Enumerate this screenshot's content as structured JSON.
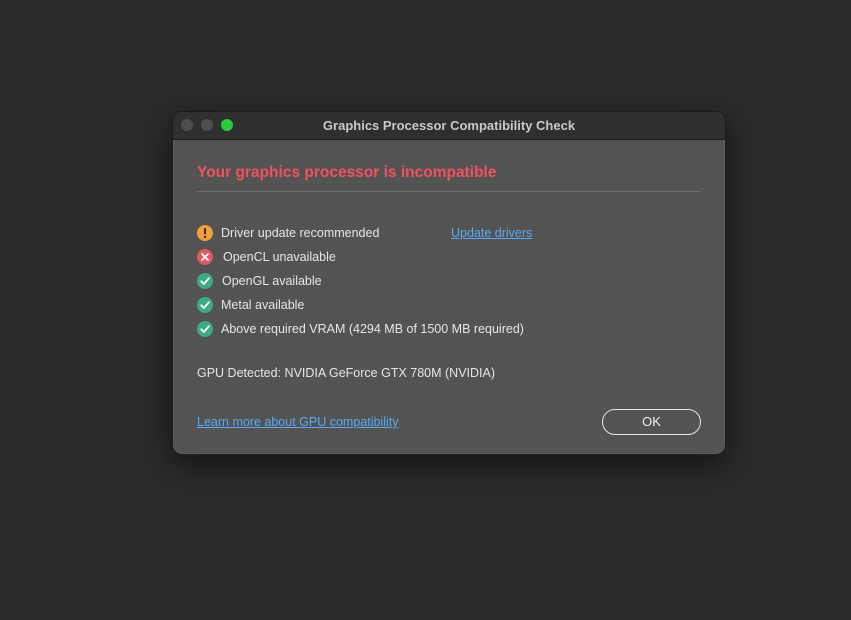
{
  "window": {
    "title": "Graphics Processor Compatibility Check"
  },
  "heading": "Your graphics processor is incompatible",
  "checks": [
    {
      "status": "warning",
      "icon": "exclamation-icon",
      "label": "Driver update recommended"
    },
    {
      "status": "error",
      "icon": "x-icon",
      "label": "OpenCL unavailable"
    },
    {
      "status": "ok",
      "icon": "checkmark-icon",
      "label": "OpenGL available"
    },
    {
      "status": "ok",
      "icon": "checkmark-icon",
      "label": "Metal available"
    },
    {
      "status": "ok",
      "icon": "checkmark-icon",
      "label": "Above required VRAM (4294 MB of 1500 MB required)"
    }
  ],
  "update_drivers_link": "Update drivers",
  "gpu_detected": "GPU Detected: NVIDIA GeForce GTX 780M (NVIDIA)",
  "learn_more_link": "Learn more about GPU compatibility",
  "ok_button": "OK",
  "colors": {
    "background": "#2b2b2b",
    "dialog": "#535353",
    "heading": "#f0535f",
    "link": "#5aa9f2",
    "warning": "#f4a03a",
    "error": "#dd5a5e",
    "success": "#3fab85",
    "zoom_button": "#2ac940"
  }
}
